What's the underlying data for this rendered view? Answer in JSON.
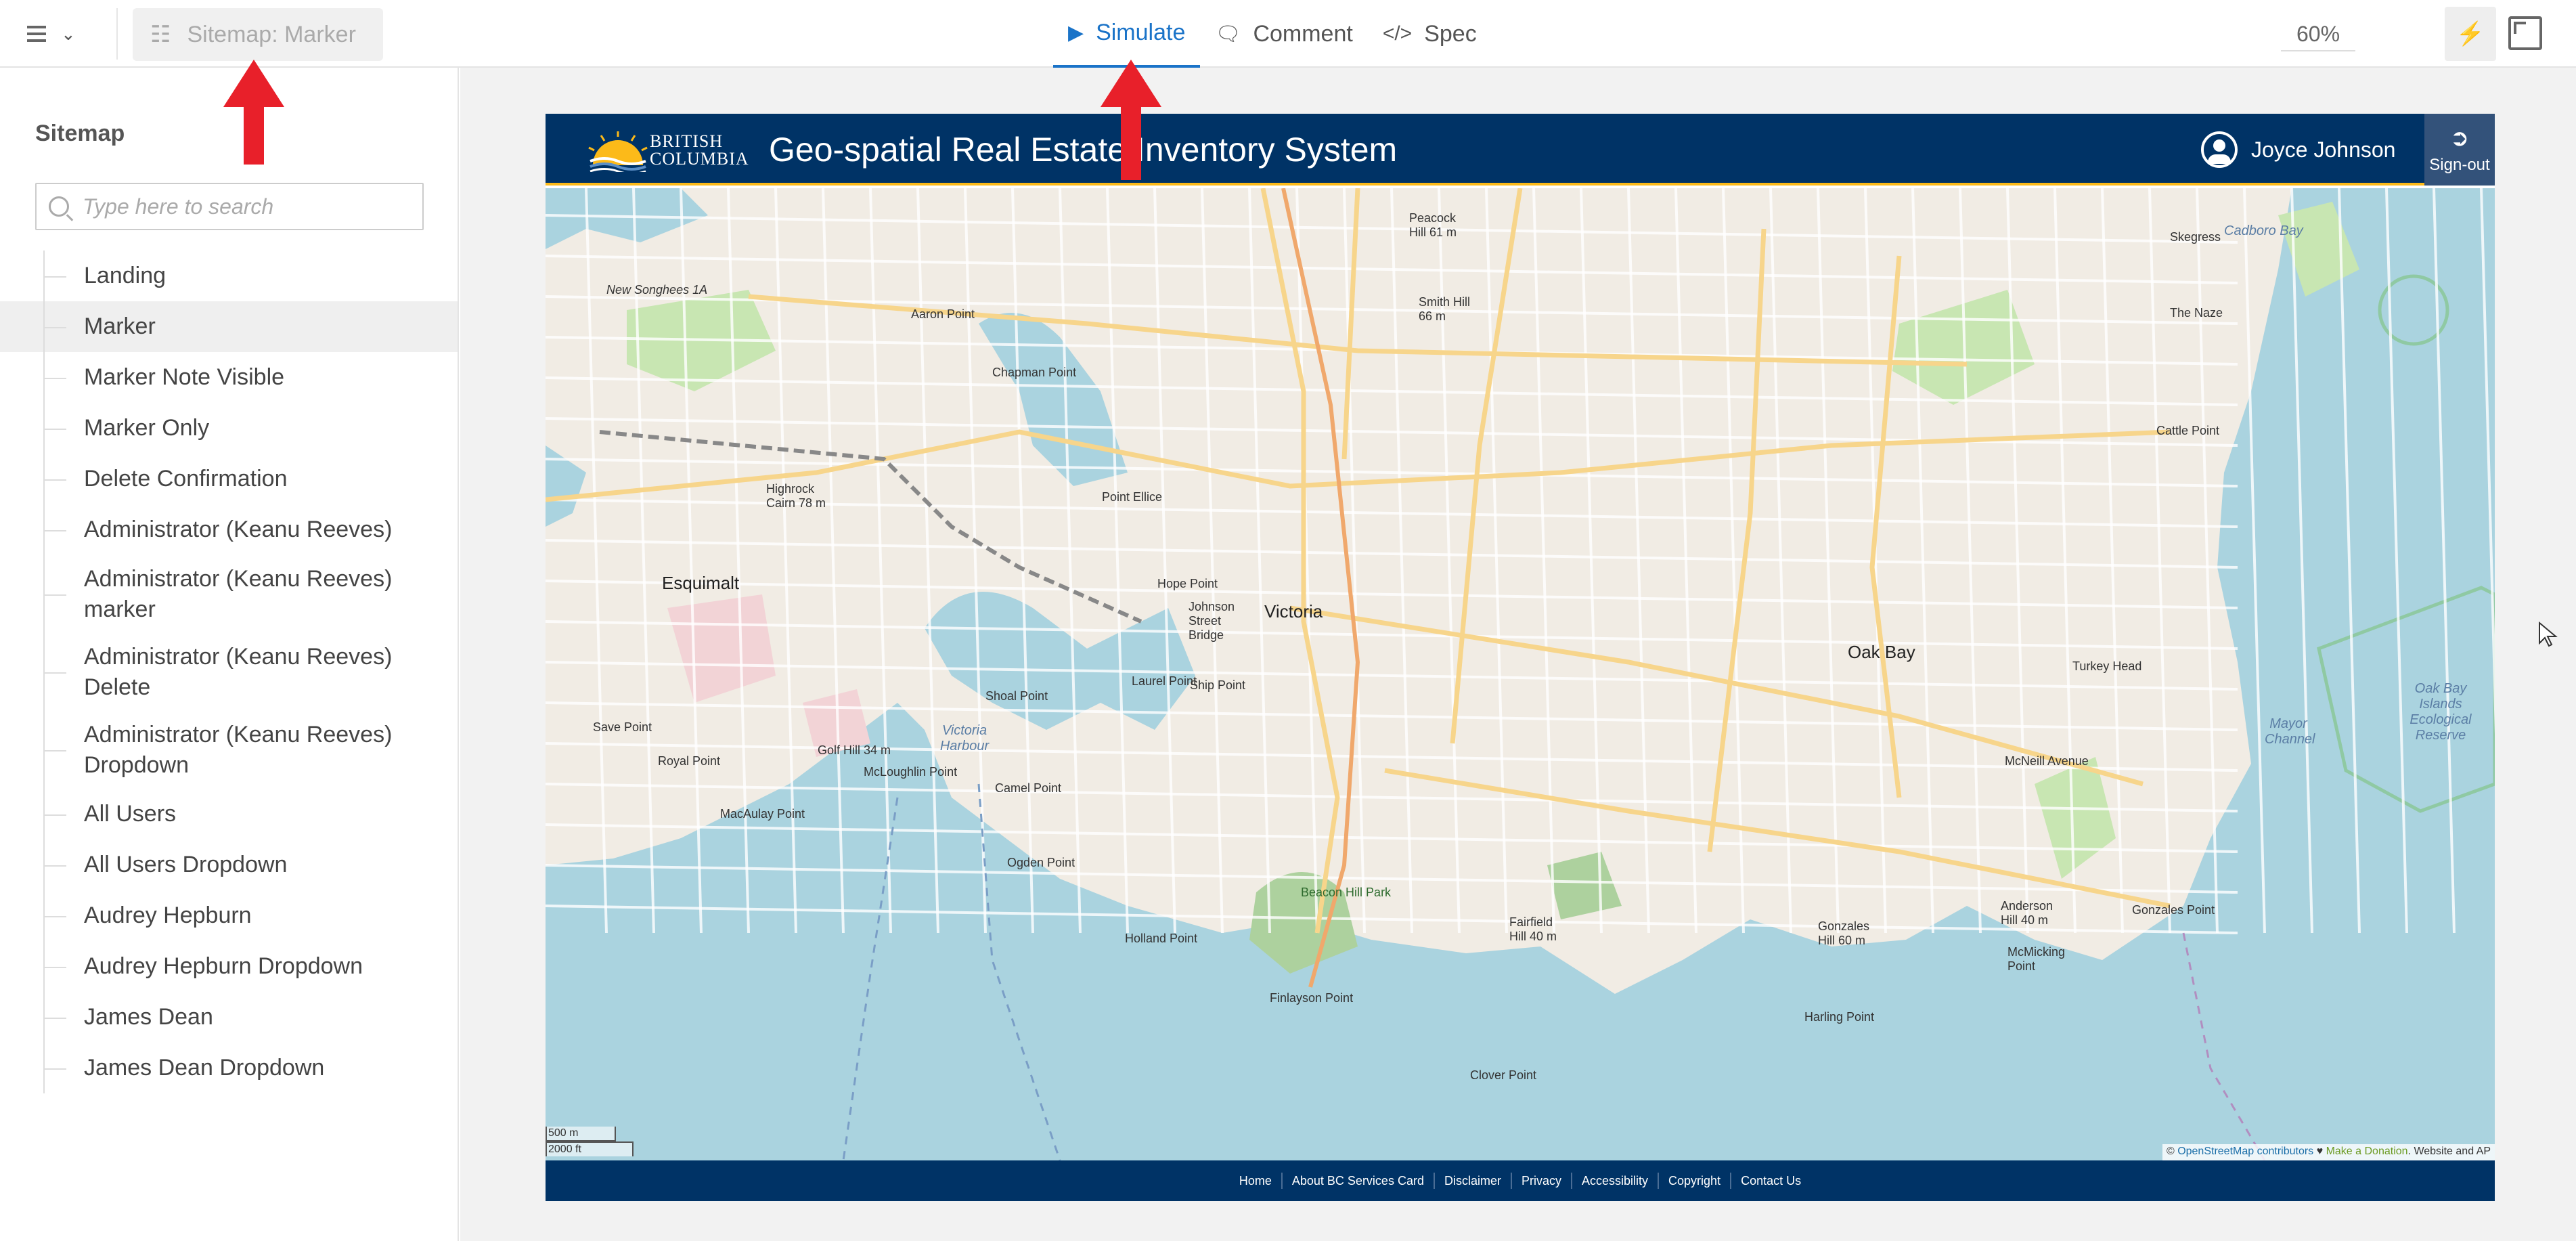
{
  "toolbar": {
    "sitemap_chip": "Sitemap: Marker",
    "tabs": [
      {
        "label": "Simulate",
        "icon": "play-icon"
      },
      {
        "label": "Comment",
        "icon": "comment-icon"
      },
      {
        "label": "Spec",
        "icon": "code-icon"
      }
    ],
    "zoom": "60%"
  },
  "sidebar": {
    "title": "Sitemap",
    "search_placeholder": "Type here to search",
    "items": [
      {
        "label": "Landing"
      },
      {
        "label": "Marker"
      },
      {
        "label": "Marker Note Visible"
      },
      {
        "label": "Marker Only"
      },
      {
        "label": "Delete Confirmation"
      },
      {
        "label": "Administrator (Keanu Reeves)"
      },
      {
        "label": "Administrator (Keanu Reeves) marker"
      },
      {
        "label": "Administrator (Keanu Reeves) Delete"
      },
      {
        "label": "Administrator (Keanu Reeves) Dropdown"
      },
      {
        "label": "All Users"
      },
      {
        "label": "All Users Dropdown"
      },
      {
        "label": "Audrey Hepburn"
      },
      {
        "label": "Audrey Hepburn Dropdown"
      },
      {
        "label": "James Dean"
      },
      {
        "label": "James Dean Dropdown"
      }
    ],
    "active_index": 1
  },
  "prototype": {
    "logo_text_line1": "BRITISH",
    "logo_text_line2": "COLUMBIA",
    "app_title": "Geo-spatial Real Estate Inventory System",
    "user_name": "Joyce Johnson",
    "signout_label": "Sign-out",
    "colors": {
      "header": "#003366",
      "accent": "#fcba19",
      "water": "#aad3df"
    },
    "map": {
      "labels": {
        "victoria": "Victoria",
        "esquimalt": "Esquimalt",
        "oak_bay": "Oak Bay",
        "cadboro_bay": "Cadboro Bay",
        "oak_bay_reserve": "Oak Bay Islands Ecological Reserve",
        "new_songhees": "New Songhees 1A",
        "save_point": "Save Point",
        "royal_point": "Royal Point",
        "golf_hill": "Golf Hill 34 m",
        "beacon_hill": "Beacon Hill Park",
        "clover_point": "Clover Point",
        "gonzales_point": "Gonzales Point",
        "mcneill_avenue": "McNeill Avenue",
        "turkey_head": "Turkey Head",
        "ship_point": "Ship Point",
        "shoal_point": "Shoal Point",
        "camel_point": "Camel Point",
        "ogden_point": "Ogden Point",
        "holland_point": "Holland Point",
        "finlayson_point": "Finlayson Point",
        "harling_point": "Harling Point",
        "cattle_point": "Cattle Point",
        "the_naze": "The Naze",
        "skegress": "Skegress",
        "point_ellice": "Point Ellice",
        "hope_point": "Hope Point",
        "johnson_street_bridge": "Johnson Street Bridge",
        "laurel_point": "Laurel Point",
        "mcaulay_point": "MacAulay Point",
        "mclaughlin_point": "McLoughlin Point",
        "aaron_point": "Aaron Point",
        "chapman_point": "Chapman Point",
        "highrock_cairn": "Highrock Cairn 78 m",
        "smith_hill": "Smith Hill 66 m",
        "peacock_hill": "Peacock Hill 61 m",
        "fairfield_hill": "Fairfield Hill 40 m",
        "gonzales_hill": "Gonzales Hill 60 m",
        "anderson_hill": "Anderson Hill 40 m",
        "mcmicking_point": "McMicking Point",
        "victoria_harbour": "Victoria Harbour",
        "mayor_channel": "Mayor Channel",
        "scale_m": "500 m",
        "scale_ft": "2000 ft"
      },
      "attribution_prefix": "© ",
      "attribution_osm": "OpenStreetMap contributors",
      "attribution_heart": " ♥ ",
      "attribution_donate": "Make a Donation",
      "attribution_rest": ". Website and AP"
    },
    "footer_links": [
      "Home",
      "About BC Services Card",
      "Disclaimer",
      "Privacy",
      "Accessibility",
      "Copyright",
      "Contact Us"
    ]
  }
}
